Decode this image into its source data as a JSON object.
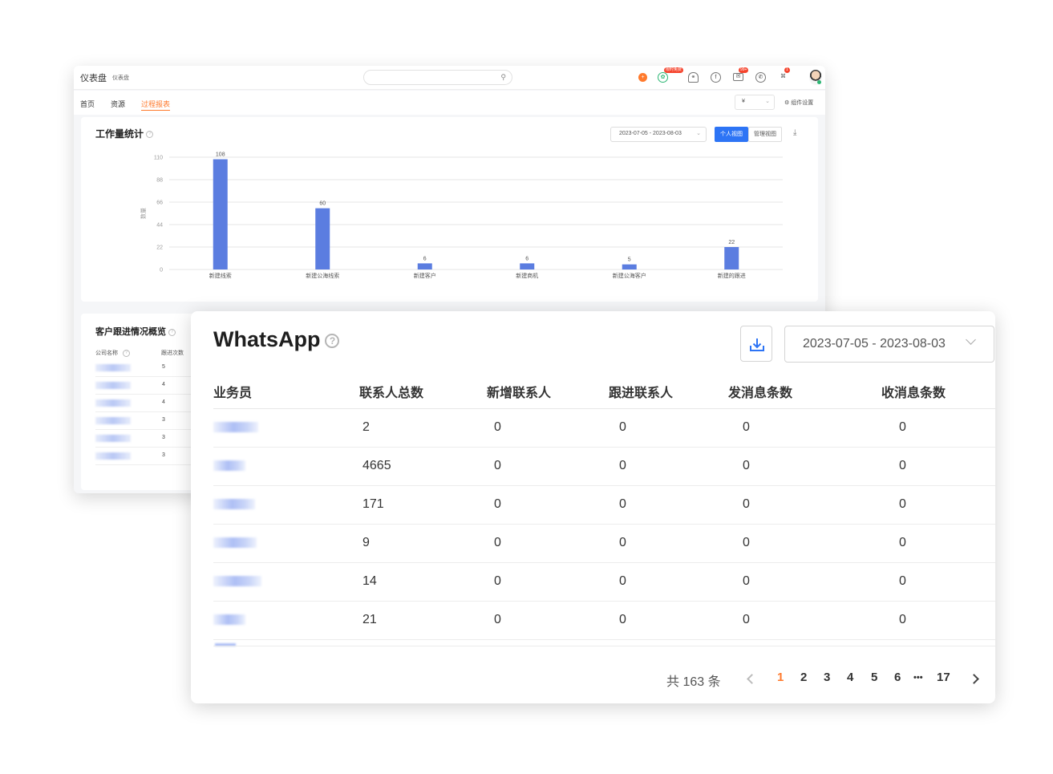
{
  "topbar": {
    "title": "仪表盘",
    "subtitle": "仪表盘",
    "badge_free": "限时免费",
    "badge_mail": "99+",
    "badge_grid": "1"
  },
  "nav": {
    "items": [
      "首页",
      "资源",
      "过程报表"
    ],
    "active_index": 2,
    "currency": "¥",
    "widget_settings": "组件设置"
  },
  "workload": {
    "title": "工作量统计",
    "date_range": "2023-07-05 - 2023-08-03",
    "btn_personal": "个人视图",
    "btn_manage": "管理视图",
    "colors": {
      "bar": "#5b7de0",
      "accent": "#2d74f5"
    }
  },
  "chart_data": {
    "type": "bar",
    "title": "工作量统计",
    "categories": [
      "新建线索",
      "新建公海线索",
      "新建客户",
      "新建商机",
      "新建公海客户",
      "新建的跟进"
    ],
    "values": [
      108,
      60,
      6,
      6,
      5,
      22
    ],
    "ylabel": "数量",
    "yticks": [
      0,
      22,
      44,
      66,
      88,
      110
    ],
    "ylim": [
      0,
      110
    ],
    "grid": true
  },
  "followup": {
    "title": "客户跟进情况概览",
    "col_company": "公司名称",
    "col_count": "跟进次数",
    "counts": [
      "5",
      "4",
      "4",
      "3",
      "3",
      "3"
    ]
  },
  "whatsapp": {
    "title": "WhatsApp",
    "help": "?",
    "date_range": "2023-07-05 - 2023-08-03",
    "columns": [
      "业务员",
      "联系人总数",
      "新增联系人",
      "跟进联系人",
      "发消息条数",
      "收消息条数"
    ],
    "rows": [
      [
        "2",
        "0",
        "0",
        "0",
        "0"
      ],
      [
        "4665",
        "0",
        "0",
        "0",
        "0"
      ],
      [
        "171",
        "0",
        "0",
        "0",
        "0"
      ],
      [
        "9",
        "0",
        "0",
        "0",
        "0"
      ],
      [
        "14",
        "0",
        "0",
        "0",
        "0"
      ],
      [
        "21",
        "0",
        "0",
        "0",
        "0"
      ]
    ],
    "total": "共 163 条",
    "pages": [
      "1",
      "2",
      "3",
      "4",
      "5",
      "6",
      "•••",
      "17"
    ],
    "current_page": 1,
    "accent_color": "#ff7a2d"
  }
}
